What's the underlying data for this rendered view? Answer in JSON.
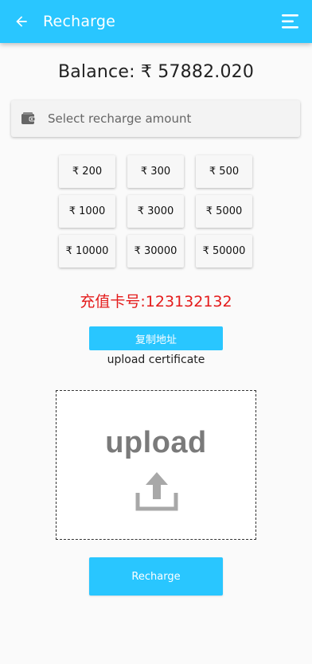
{
  "header": {
    "title": "Recharge",
    "back_icon": "arrow-left-icon",
    "menu_icon": "menu-icon",
    "bar_color": "#29c6ff"
  },
  "balance": {
    "text": "Balance: ₹ 57882.020"
  },
  "amount_select": {
    "placeholder": "Select recharge amount",
    "icon": "wallet-icon"
  },
  "amount_options": [
    "₹ 200",
    "₹ 300",
    "₹ 500",
    "₹ 1000",
    "₹ 3000",
    "₹ 5000",
    "₹ 10000",
    "₹ 30000",
    "₹ 50000"
  ],
  "card_number": {
    "text": "充值卡号:123132132",
    "color": "#e41b1b"
  },
  "copy_button": {
    "label": "复制地址"
  },
  "upload": {
    "label": "upload certificate",
    "zone_text": "upload",
    "icon": "upload-icon"
  },
  "recharge_button": {
    "label": "Recharge"
  }
}
